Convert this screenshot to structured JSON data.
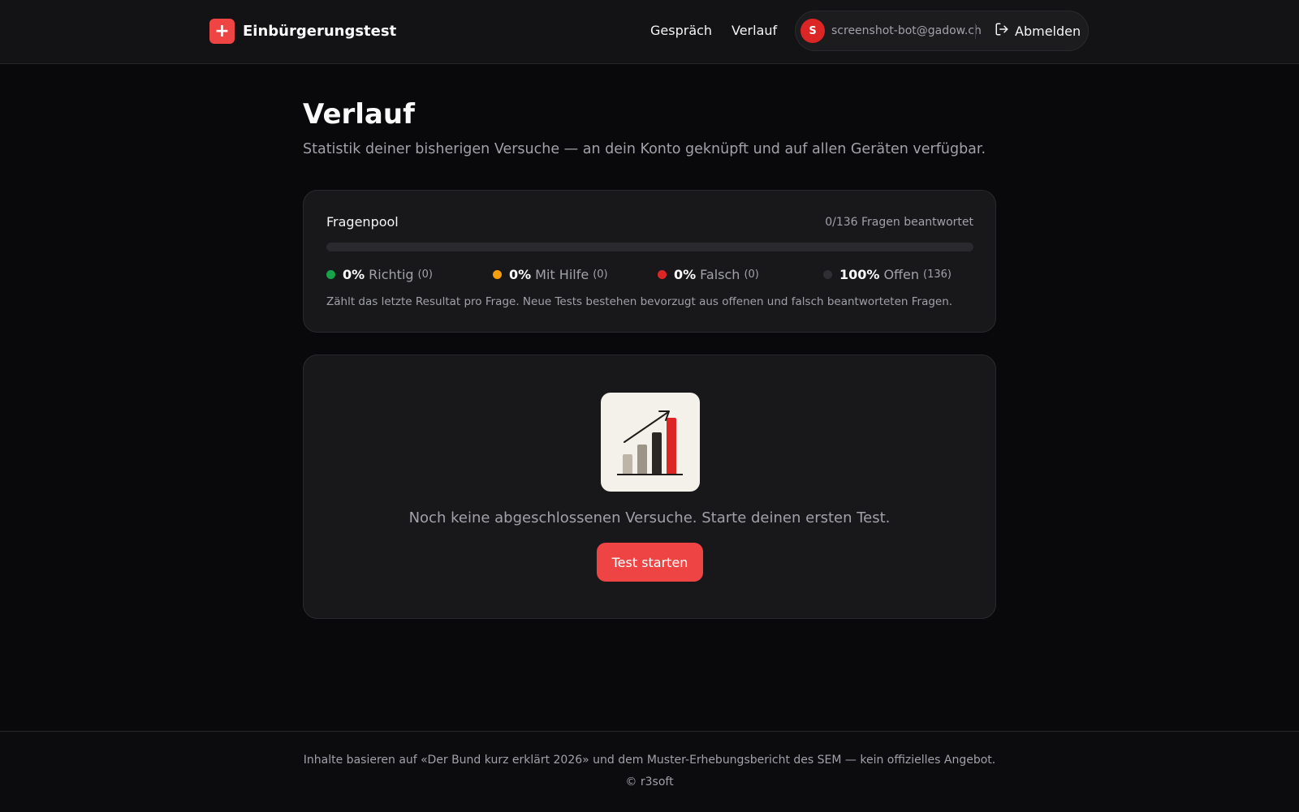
{
  "header": {
    "brand_name": "Einbürgerungstest",
    "nav": {
      "talk_label": "Gespräch",
      "history_label": "Verlauf"
    },
    "user": {
      "avatar_initial": "S",
      "email": "screenshot-bot@gadow.ch",
      "logout_label": "Abmelden"
    }
  },
  "page": {
    "title": "Verlauf",
    "subtitle": "Statistik deiner bisherigen Versuche — an dein Konto geknüpft und auf allen Geräten verfügbar."
  },
  "pool": {
    "title": "Fragenpool",
    "answered_summary": "0/136 Fragen beantwortet",
    "progress_fraction": 0,
    "legend": [
      {
        "pct": "0%",
        "label": "Richtig",
        "count": "(0)",
        "color": "#16a34a"
      },
      {
        "pct": "0%",
        "label": "Mit Hilfe",
        "count": "(0)",
        "color": "#f59e0b"
      },
      {
        "pct": "0%",
        "label": "Falsch",
        "count": "(0)",
        "color": "#dc2626"
      },
      {
        "pct": "100%",
        "label": "Offen",
        "count": "(136)",
        "color": "#2e2e33"
      }
    ],
    "note": "Zählt das letzte Resultat pro Frage. Neue Tests bestehen bevorzugt aus offenen und falsch beantworteten Fragen."
  },
  "empty_state": {
    "icon": "chart-growth-icon",
    "message": "Noch keine abgeschlossenen Versuche. Starte deinen ersten Test.",
    "button_label": "Test starten"
  },
  "footer": {
    "note": "Inhalte basieren auf «Der Bund kurz erklärt 2026» und dem Muster-Erhebungsbericht des SEM — kein offizielles Angebot.",
    "copyright": "© r3soft"
  },
  "colors": {
    "accent": "#ef4444",
    "background": "#09090b",
    "card": "#18181b"
  }
}
